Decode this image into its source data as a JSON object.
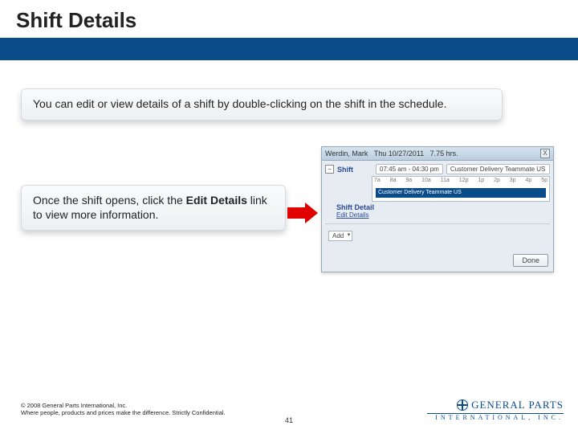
{
  "header": {
    "title": "Shift Details"
  },
  "body": {
    "callout1": "You can edit or view details of a shift by double-clicking on the shift in the schedule.",
    "callout2_pre": "Once the shift opens, click the ",
    "callout2_bold": "Edit Details",
    "callout2_post": " link to view more information."
  },
  "mock": {
    "header_name": "Werdin, Mark",
    "header_date": "Thu 10/27/2011",
    "header_hours": "7.75 hrs.",
    "close": "X",
    "expander": "−",
    "shift_label": "Shift",
    "time_chip": "07:45 am - 04:30 pm",
    "role_chip": "Customer Delivery Teammate US",
    "ticks": [
      "7a",
      "8a",
      "9a",
      "10a",
      "11a",
      "12p",
      "1p",
      "2p",
      "3p",
      "4p",
      "5p"
    ],
    "bar_text": "Customer Delivery Teammate US",
    "detail_label": "Shift Detail",
    "edit_link": "Edit Details",
    "add_label": "Add",
    "done_btn": "Done"
  },
  "footer": {
    "copyright_line1": "© 2008 General Parts International, Inc.",
    "copyright_line2": "Where people, products and prices make the difference. Strictly Confidential.",
    "slide_number": "41",
    "logo_line1": "GENERAL PARTS",
    "logo_line2": "INTERNATIONAL, INC."
  }
}
